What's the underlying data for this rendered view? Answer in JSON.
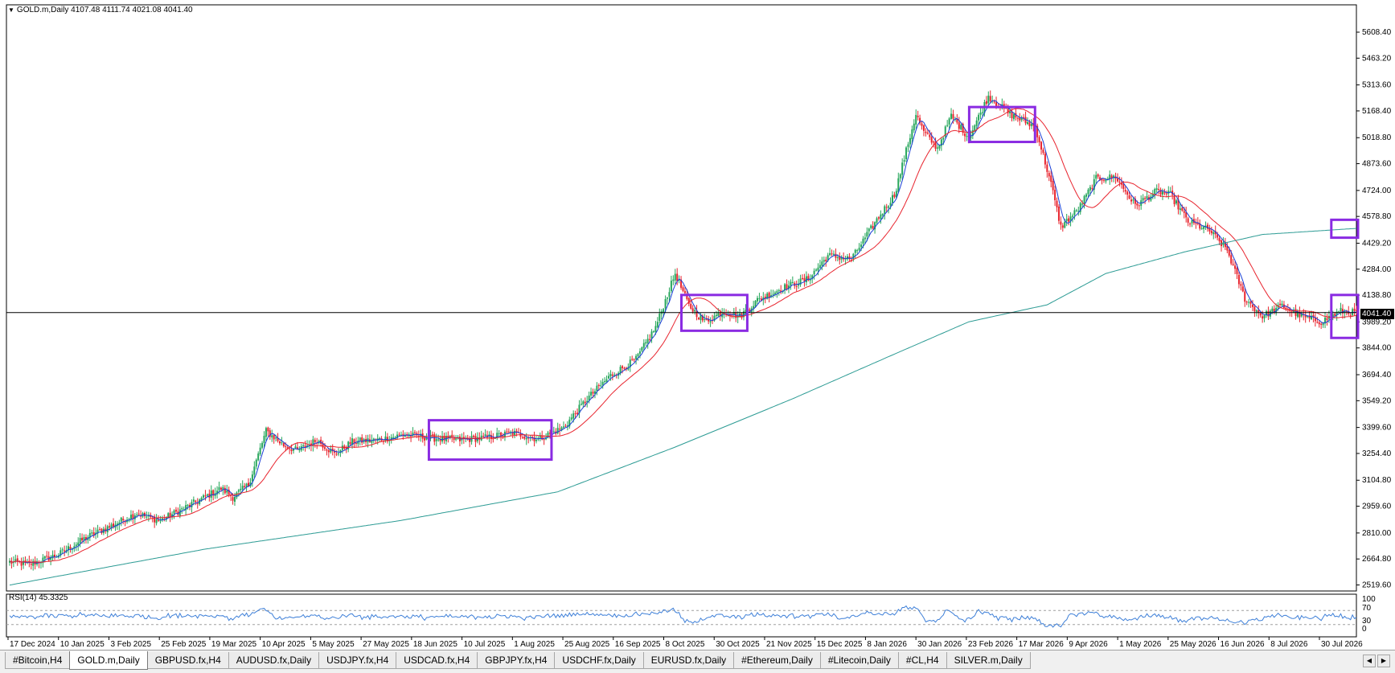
{
  "window": {
    "symbol_line": "GOLD.m,Daily  4107.48 4111.74 4021.08 4041.40",
    "rsi_label": "RSI(14) 45.3325",
    "current_price_label": "4041.40"
  },
  "price_axis": {
    "ticks": [
      "5608.40",
      "5463.20",
      "5313.60",
      "5168.40",
      "5018.80",
      "4873.60",
      "4724.00",
      "4578.80",
      "4429.20",
      "4284.00",
      "4138.80",
      "3989.20",
      "3844.00",
      "3694.40",
      "3549.20",
      "3399.60",
      "3254.40",
      "3104.80",
      "2959.60",
      "2810.00",
      "2664.80",
      "2519.60"
    ],
    "current_price": 4041.4
  },
  "rsi_axis": {
    "ticks": [
      "100",
      "70",
      "30",
      "0"
    ],
    "levels": [
      70,
      30
    ]
  },
  "time_axis": {
    "labels": [
      "17 Dec 2024",
      "10 Jan 2025",
      "3 Feb 2025",
      "25 Feb 2025",
      "19 Mar 2025",
      "10 Apr 2025",
      "5 May 2025",
      "27 May 2025",
      "18 Jun 2025",
      "10 Jul 2025",
      "1 Aug 2025",
      "25 Aug 2025",
      "16 Sep 2025",
      "8 Oct 2025",
      "30 Oct 2025",
      "21 Nov 2025",
      "15 Dec 2025",
      "8 Jan 2026",
      "30 Jan 2026",
      "23 Feb 2026",
      "17 Mar 2026",
      "9 Apr 2026",
      "1 May 2026",
      "25 May 2026",
      "16 Jun 2026",
      "8 Jul 2026",
      "30 Jul 2026"
    ]
  },
  "colors": {
    "bull": "#26a65b",
    "bear": "#e8242e",
    "ma_fast": "#1a3fd6",
    "ma_slow": "#e8242e",
    "ma_long": "#2c9b94",
    "rsi": "#3d7fd8",
    "highlight_box": "#8a2be2"
  },
  "chart_data": {
    "type": "candlestick",
    "price_anchors": [
      [
        0,
        2648
      ],
      [
        10,
        2635
      ],
      [
        25,
        2690
      ],
      [
        40,
        2790
      ],
      [
        52,
        2850
      ],
      [
        65,
        2922
      ],
      [
        70,
        2900
      ],
      [
        77,
        2880
      ],
      [
        85,
        2925
      ],
      [
        98,
        3000
      ],
      [
        108,
        3060
      ],
      [
        114,
        3010
      ],
      [
        122,
        3080
      ],
      [
        131,
        3380
      ],
      [
        140,
        3300
      ],
      [
        147,
        3270
      ],
      [
        157,
        3330
      ],
      [
        166,
        3250
      ],
      [
        175,
        3320
      ],
      [
        188,
        3330
      ],
      [
        202,
        3360
      ],
      [
        215,
        3340
      ],
      [
        230,
        3330
      ],
      [
        245,
        3345
      ],
      [
        257,
        3370
      ],
      [
        270,
        3335
      ],
      [
        283,
        3400
      ],
      [
        295,
        3560
      ],
      [
        307,
        3690
      ],
      [
        320,
        3780
      ],
      [
        330,
        3960
      ],
      [
        340,
        4260
      ],
      [
        347,
        4080
      ],
      [
        355,
        3990
      ],
      [
        365,
        4050
      ],
      [
        373,
        4020
      ],
      [
        382,
        4110
      ],
      [
        395,
        4180
      ],
      [
        408,
        4230
      ],
      [
        418,
        4360
      ],
      [
        430,
        4340
      ],
      [
        443,
        4560
      ],
      [
        452,
        4700
      ],
      [
        463,
        5150
      ],
      [
        467,
        5050
      ],
      [
        474,
        4960
      ],
      [
        481,
        5140
      ],
      [
        490,
        5020
      ],
      [
        500,
        5250
      ],
      [
        511,
        5150
      ],
      [
        524,
        5080
      ],
      [
        532,
        4760
      ],
      [
        537,
        4520
      ],
      [
        546,
        4620
      ],
      [
        555,
        4790
      ],
      [
        565,
        4800
      ],
      [
        575,
        4640
      ],
      [
        586,
        4720
      ],
      [
        593,
        4700
      ],
      [
        602,
        4550
      ],
      [
        613,
        4500
      ],
      [
        622,
        4390
      ],
      [
        631,
        4120
      ],
      [
        640,
        4020
      ],
      [
        650,
        4080
      ],
      [
        660,
        4020
      ],
      [
        670,
        3990
      ],
      [
        680,
        4050
      ],
      [
        688,
        4040
      ]
    ],
    "long_ma_anchors": [
      [
        0,
        2519
      ],
      [
        100,
        2720
      ],
      [
        200,
        2880
      ],
      [
        280,
        3040
      ],
      [
        340,
        3290
      ],
      [
        400,
        3560
      ],
      [
        450,
        3800
      ],
      [
        490,
        3990
      ],
      [
        530,
        4085
      ],
      [
        560,
        4260
      ],
      [
        600,
        4380
      ],
      [
        640,
        4478
      ],
      [
        688,
        4512
      ]
    ],
    "highlight_boxes": [
      {
        "bar_from": 215,
        "bar_to": 276,
        "price_top": 3440,
        "price_bottom": 3220
      },
      {
        "bar_from": 344,
        "bar_to": 376,
        "price_top": 4140,
        "price_bottom": 3940
      },
      {
        "bar_from": 491,
        "bar_to": 523,
        "price_top": 5190,
        "price_bottom": 4995
      },
      {
        "bar_from": 676,
        "bar_to": 688,
        "price_top": 4560,
        "price_bottom": 4460
      },
      {
        "bar_from": 676,
        "bar_to": 688,
        "price_top": 4140,
        "price_bottom": 3900
      }
    ],
    "indicators": [
      "MA fast (blue)",
      "MA slow (red)",
      "MA long (teal)",
      "RSI(14)"
    ]
  },
  "tabs": [
    "#Bitcoin,H4",
    "GOLD.m,Daily",
    "GBPUSD.fx,H4",
    "AUDUSD.fx,Daily",
    "USDJPY.fx,H4",
    "USDCAD.fx,H4",
    "GBPJPY.fx,H4",
    "USDCHF.fx,Daily",
    "EURUSD.fx,Daily",
    "#Ethereum,Daily",
    "#Litecoin,Daily",
    "#CL,H4",
    "SILVER.m,Daily"
  ],
  "active_tab": 1
}
